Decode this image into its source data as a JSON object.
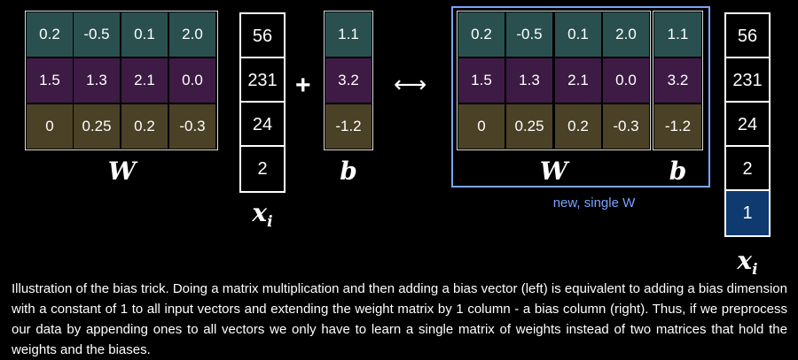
{
  "W": [
    [
      "0.2",
      "-0.5",
      "0.1",
      "2.0"
    ],
    [
      "1.5",
      "1.3",
      "2.1",
      "0.0"
    ],
    [
      "0",
      "0.25",
      "0.2",
      "-0.3"
    ]
  ],
  "b": [
    "1.1",
    "3.2",
    "-1.2"
  ],
  "x": [
    "56",
    "231",
    "24",
    "2"
  ],
  "x_ext": [
    "56",
    "231",
    "24",
    "2",
    "1"
  ],
  "labels": {
    "W": "W",
    "b": "b",
    "xi": "x",
    "sub": "i"
  },
  "operators": {
    "plus": "+",
    "equiv": "⟷"
  },
  "highlight_label": "new, single W",
  "caption": "Illustration of the bias trick. Doing a matrix multiplication and then adding a bias vector (left) is equivalent to adding a bias dimension with a constant of 1 to all input vectors and extending the weight matrix by 1 column - a bias column (right). Thus, if we preprocess our data by appending ones to all vectors we only have to learn a single matrix of weights instead of two matrices that hold the weights and the biases.",
  "colors": {
    "row0": "#29504f",
    "row1": "#3d1b45",
    "row2": "#4a4126",
    "one": "#0f3a70",
    "highlight": "#7aa4ff"
  }
}
